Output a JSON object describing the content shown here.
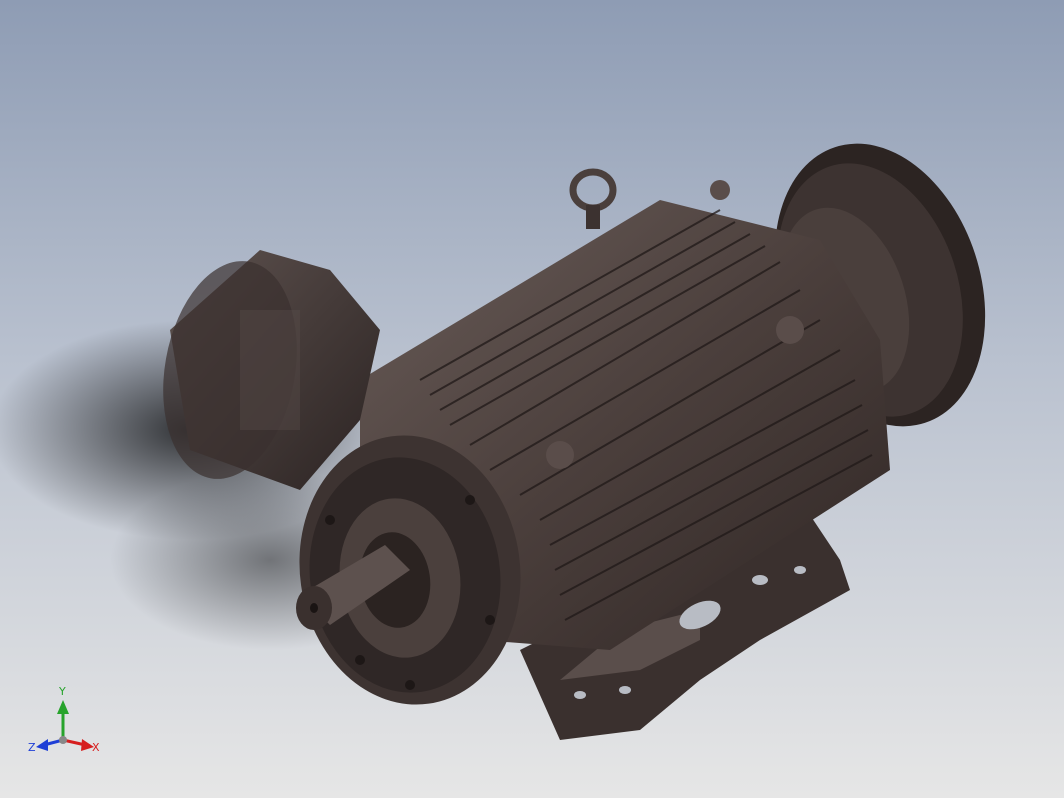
{
  "viewport": {
    "background_top": "#8e9cb4",
    "background_bottom": "#e6e6e6",
    "model_color": "#4a3e3b",
    "model_shadow": "#2b2221"
  },
  "model": {
    "icon": "electric-motor-icon"
  },
  "triad": {
    "x_label": "X",
    "y_label": "Y",
    "z_label": "Z",
    "x_color": "#d61e1e",
    "y_color": "#27a32c",
    "z_color": "#1f3fd6"
  }
}
